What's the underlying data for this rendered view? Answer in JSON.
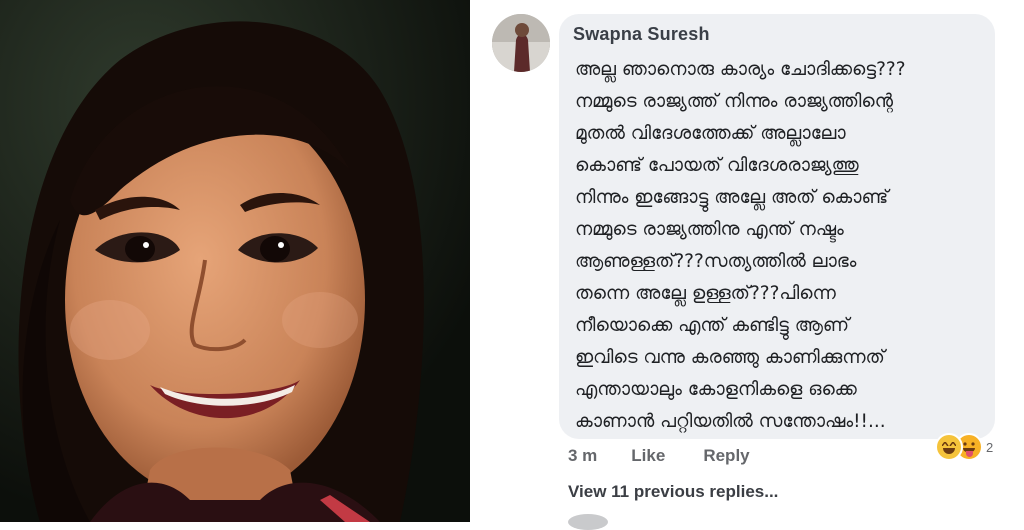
{
  "comment": {
    "author": "Swapna Suresh",
    "lines": [
      "അല്ല ഞാനൊരു കാര്യം ചോദിക്കട്ടെ???",
      "നമ്മുടെ രാജ്യത്ത് നിന്നും രാജ്യത്തിന്റെ",
      "മുതൽ വിദേശത്തേക്ക് അല്ലാലോ",
      "കൊണ്ട് പോയത് വിദേശരാജ്യത്തു",
      "നിന്നും ഇങ്ങോട്ടു അല്ലേ അത് കൊണ്ട്",
      "നമ്മുടെ രാജ്യത്തിനു എന്ത് നഷ്ടം",
      "ആണുള്ളത്???സത്യത്തിൽ ലാഭം",
      "തന്നെ അല്ലേ ഉള്ളത്???പിന്നെ",
      "നീയൊക്കെ എന്ത് കണ്ടിട്ടു ആണ്",
      "ഇവിടെ വന്നു കരഞ്ഞു കാണിക്കുന്നത്",
      "എന്തായാലും കോളനികളെ ഒക്കെ",
      "കാണാൻ പറ്റിയതിൽ സന്തോഷം!!..."
    ],
    "reactions": {
      "icons": [
        "haha-icon",
        "tongue-face-icon"
      ],
      "count": "2"
    },
    "actions": {
      "time": "3 m",
      "like": "Like",
      "reply": "Reply"
    },
    "view_replies": "View 11 previous replies..."
  },
  "colors": {
    "bubble": "#eef0f3",
    "author_text": "#3a3f47",
    "action_text": "#65676b",
    "body_text": "#1f2124"
  }
}
